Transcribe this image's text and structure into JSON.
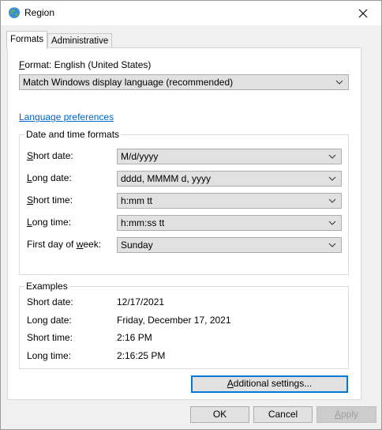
{
  "window": {
    "title": "Region",
    "icon": "globe-icon",
    "close_icon": "close-icon"
  },
  "tabs": [
    {
      "label": "Formats",
      "active": true
    },
    {
      "label": "Administrative",
      "active": false
    }
  ],
  "formats": {
    "format_label_prefix": "F",
    "format_label_rest": "ormat: English (United States)",
    "format_value": "Match Windows display language (recommended)",
    "language_link": "Language preferences",
    "date_time_group_title": "Date and time formats",
    "fields": [
      {
        "label_u": "S",
        "label_rest": "hort date:",
        "value": "M/d/yyyy"
      },
      {
        "label_u": "L",
        "label_rest": "ong date:",
        "value": "dddd, MMMM d, yyyy"
      },
      {
        "label_u": "S",
        "label_rest": "hort time:",
        "value": "h:mm tt"
      },
      {
        "label_u": "L",
        "label_rest": "ong time:",
        "value": "h:mm:ss tt"
      },
      {
        "label_pre": "First day of ",
        "label_u": "w",
        "label_rest": "eek:",
        "value": "Sunday"
      }
    ],
    "examples_title": "Examples",
    "examples": [
      {
        "label": "Short date:",
        "value": "12/17/2021"
      },
      {
        "label": "Long date:",
        "value": "Friday, December 17, 2021"
      },
      {
        "label": "Short time:",
        "value": "2:16 PM"
      },
      {
        "label": "Long time:",
        "value": "2:16:25 PM"
      }
    ],
    "additional_settings_u": "A",
    "additional_settings_rest": "dditional settings..."
  },
  "footer": {
    "ok": "OK",
    "cancel": "Cancel",
    "apply_u": "A",
    "apply_rest": "pply"
  }
}
